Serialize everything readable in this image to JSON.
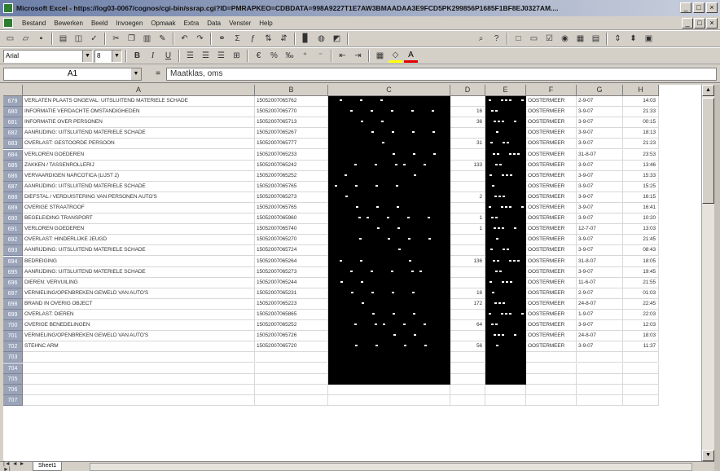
{
  "window": {
    "title": "Microsoft Excel - https://log03-0067/cognos/cgi-bin/ssrap.cgi?ID=PMRAPKEO=CDBDATA=998A9227T1E7AW3BMAADAA3E9FCD5PK299856P1685F1BF8EJ0327AM....",
    "controls": [
      "_",
      "□",
      "×"
    ]
  },
  "menu": {
    "items": [
      "Bestand",
      "Bewerken",
      "Beeld",
      "Invoegen",
      "Opmaak",
      "Extra",
      "Data",
      "Venster",
      "Help"
    ]
  },
  "toolbar2": {
    "font": "Arial",
    "size": "8"
  },
  "formula_bar": {
    "cell_ref": "A1",
    "equals": "=",
    "content": "Maatklas, oms"
  },
  "columns": [
    {
      "letter": "A"
    },
    {
      "letter": "B"
    },
    {
      "letter": "C"
    },
    {
      "letter": "D"
    },
    {
      "letter": "E"
    },
    {
      "letter": "F"
    },
    {
      "letter": "G"
    },
    {
      "letter": "H"
    }
  ],
  "rows": [
    {
      "n": "679",
      "a": "VERLATEN PLAATS ONGEVAL: UITSLUITEND MATERIELE SCHADE",
      "b": "15052007065762",
      "d": "",
      "f": "OOSTERMEER",
      "g": "2-9-07",
      "h": "14:03"
    },
    {
      "n": "680",
      "a": "INFORMATIE VERDACHTE OMSTANDIGHEDEN",
      "b": "15052007065770",
      "d": "16",
      "f": "OOSTERMEER",
      "g": "3-9-07",
      "h": "21:33"
    },
    {
      "n": "681",
      "a": "INFORMATIE OVER PERSONEN",
      "b": "15052007065713",
      "d": "36",
      "f": "OOSTERMEER",
      "g": "3-9-07",
      "h": "00:15"
    },
    {
      "n": "682",
      "a": "AANRIJDING: UITSLUITEND MATERIELE SCHADE",
      "b": "15052007065267",
      "d": "",
      "f": "OOSTERMEER",
      "g": "3-9-07",
      "h": "18:13"
    },
    {
      "n": "683",
      "a": "OVERLAST: GESTOORDE PERSOON",
      "b": "15052007065777",
      "d": "31",
      "f": "OOSTERMEER",
      "g": "3-9-07",
      "h": "21:23"
    },
    {
      "n": "684",
      "a": "VERLOREN GOEDEREN",
      "b": "15052007065233",
      "d": "",
      "f": "OOSTERMEER",
      "g": "31-8-07",
      "h": "23:53"
    },
    {
      "n": "685",
      "a": "ZAKKEN / TASSENROLLERIJ",
      "b": "15052007065242",
      "d": "133",
      "f": "OOSTERMEER",
      "g": "3-9-07",
      "h": "13:46"
    },
    {
      "n": "686",
      "a": "VERVAARDIGEN NARCOTICA (LIJST 2)",
      "b": "15052007065252",
      "d": "",
      "f": "OOSTERMEER",
      "g": "3-9-07",
      "h": "15:33"
    },
    {
      "n": "687",
      "a": "AANRIJDING: UITSLUITEND MATERIELE SCHADE",
      "b": "15052007065765",
      "d": "",
      "f": "OOSTERMEER",
      "g": "3-9-07",
      "h": "15:25"
    },
    {
      "n": "688",
      "a": "DIEFSTAL / VERDUISTERING VAN PERSONEN AUTO'S",
      "b": "15052007065273",
      "d": "2",
      "f": "OOSTERMEER",
      "g": "3-9-07",
      "h": "16:15"
    },
    {
      "n": "689",
      "a": "OVERIGE STRAATROOF",
      "b": "15052007065765",
      "d": "",
      "f": "OOSTERMEER",
      "g": "3-9-07",
      "h": "16:41"
    },
    {
      "n": "690",
      "a": "BEGELEIDING TRANSPORT",
      "b": "15052007065960",
      "d": "1",
      "f": "OOSTERMEER",
      "g": "3-9-07",
      "h": "10:20"
    },
    {
      "n": "691",
      "a": "VERLOREN GOEDEREN",
      "b": "15052007065740",
      "d": "1",
      "f": "OOSTERMEER",
      "g": "12-7-07",
      "h": "13:03"
    },
    {
      "n": "692",
      "a": "OVERLAST: HINDERLIJKE JEUGD",
      "b": "15052007065270",
      "d": "",
      "f": "OOSTERMEER",
      "g": "3-9-07",
      "h": "21:45"
    },
    {
      "n": "693",
      "a": "AANRIJDING: UITSLUITEND MATERIELE SCHADE",
      "b": "15052007065724",
      "d": "",
      "f": "OOSTERMEER",
      "g": "3-9-07",
      "h": "08:43"
    },
    {
      "n": "694",
      "a": "BEDREIGING",
      "b": "15052007065264",
      "d": "136",
      "f": "OOSTERMEER",
      "g": "31-8-07",
      "h": "18:05"
    },
    {
      "n": "695",
      "a": "AANRIJDING: UITSLUITEND MATERIELE SCHADE",
      "b": "15052007065273",
      "d": "",
      "f": "OOSTERMEER",
      "g": "3-9-07",
      "h": "19:45"
    },
    {
      "n": "696",
      "a": "DIEREN: VERVUILING",
      "b": "15052007065244",
      "d": "",
      "f": "OOSTERMEER",
      "g": "11-6-07",
      "h": "21:55"
    },
    {
      "n": "697",
      "a": "VERNIELING/OPENBREKEN GEWELD VAN AUTO'S",
      "b": "15052007065231",
      "d": "16",
      "f": "OOSTERMEER",
      "g": "2-9-07",
      "h": "01:03"
    },
    {
      "n": "698",
      "a": "BRAND IN OVERIG OBJECT",
      "b": "15052007065223",
      "d": "172",
      "f": "OOSTERMEER",
      "g": "24-8-07",
      "h": "22:45"
    },
    {
      "n": "699",
      "a": "OVERLAST: DIEREN",
      "b": "15052007065865",
      "d": "",
      "f": "OOSTERMEER",
      "g": "1-9-07",
      "h": "22:03"
    },
    {
      "n": "700",
      "a": "OVERIGE BENEDELINGEN",
      "b": "15052007065252",
      "d": "64",
      "f": "OOSTERMEER",
      "g": "3-9-07",
      "h": "12:03"
    },
    {
      "n": "701",
      "a": "VERNIELING/OPENBREKEN GEWELD VAN AUTO'S",
      "b": "15052007065726",
      "d": "",
      "f": "OOSTERMEER",
      "g": "24-8-07",
      "h": "18:03"
    },
    {
      "n": "702",
      "a": "STEHNC ARM",
      "b": "15052007065720",
      "d": "56",
      "f": "OOSTERMEER",
      "g": "3-9-07",
      "h": "11:37"
    },
    {
      "n": "703",
      "a": "",
      "b": "",
      "d": "",
      "f": "",
      "g": "",
      "h": ""
    },
    {
      "n": "704",
      "a": "",
      "b": "",
      "d": "",
      "f": "",
      "g": "",
      "h": ""
    },
    {
      "n": "705",
      "a": "",
      "b": "",
      "d": "",
      "f": "",
      "g": "",
      "h": ""
    },
    {
      "n": "706",
      "a": "",
      "b": "",
      "d": "",
      "f": "",
      "g": "",
      "h": ""
    },
    {
      "n": "707",
      "a": "",
      "b": "",
      "d": "",
      "f": "",
      "g": "",
      "h": ""
    }
  ],
  "sheet_tabs": [
    "Sheet1"
  ],
  "tab_nav": "|◄ ◄ ► ►|"
}
